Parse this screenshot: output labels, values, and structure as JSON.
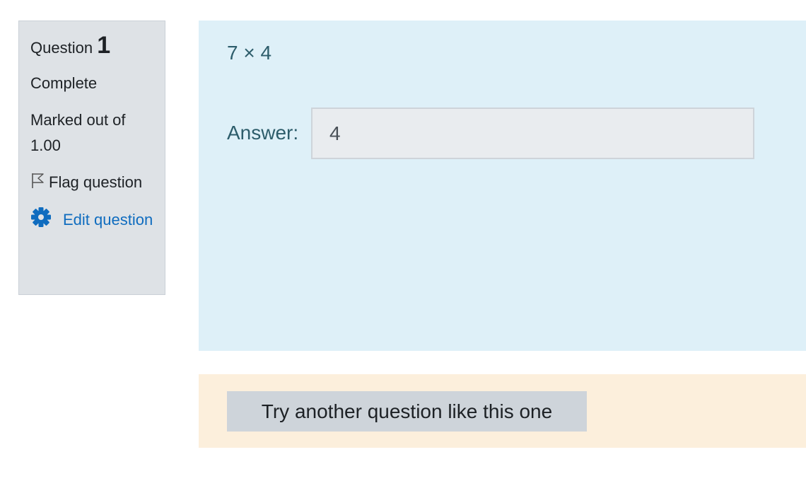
{
  "info": {
    "question_label": "Question",
    "question_number": "1",
    "state": "Complete",
    "grade": "Marked out of 1.00",
    "flag_label": "Flag question",
    "edit_label": "Edit question"
  },
  "question": {
    "text": "7 × 4",
    "answer_label": "Answer:",
    "answer_value": "4"
  },
  "actions": {
    "try_another_label": "Try another question like this one"
  },
  "icons": {
    "flag": "flag-outline-icon",
    "edit": "gear-icon"
  },
  "colors": {
    "info_bg": "#dee2e6",
    "formulation_bg": "#def0f8",
    "outcome_bg": "#fcefdc",
    "link": "#0f6cbf",
    "question_text": "#2d5d6b",
    "button_bg": "#ced4da"
  }
}
